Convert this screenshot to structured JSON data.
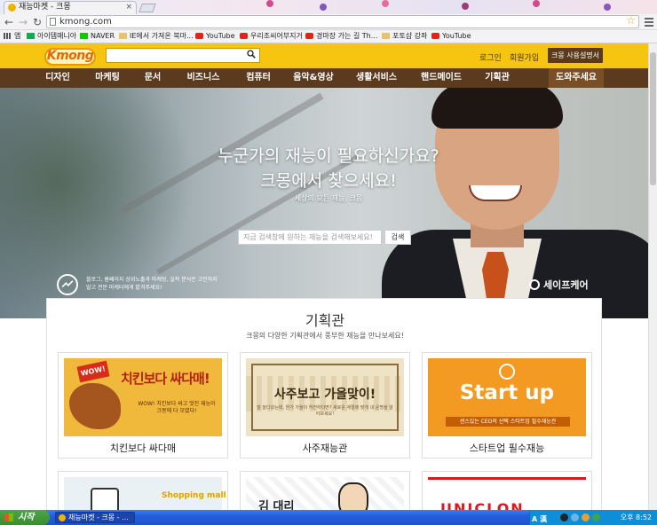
{
  "browser": {
    "tab_title": "재능마켓 - 크몽",
    "url": "kmong.com"
  },
  "bookmarks": [
    {
      "label": "앱",
      "icon": "apps-icon"
    },
    {
      "label": "아이템매니아",
      "icon": "site-icon"
    },
    {
      "label": "NAVER",
      "icon": "naver-icon"
    },
    {
      "label": "IE에서 가져온 북마...",
      "icon": "folder-icon"
    },
    {
      "label": "YouTube",
      "icon": "youtube-icon"
    },
    {
      "label": "우리조씨어부지거",
      "icon": "youtube-icon"
    },
    {
      "label": "경마장 가는 길 Th...",
      "icon": "youtube-icon"
    },
    {
      "label": "포토샵 강좌",
      "icon": "folder-icon"
    },
    {
      "label": "YouTube",
      "icon": "youtube-icon"
    }
  ],
  "header": {
    "logo": "Kmong",
    "search_placeholder": "",
    "login": "로그인",
    "signup": "회원가입",
    "guide_button": "크몽 사용설명서"
  },
  "categories": [
    "디자인",
    "마케팅",
    "문서",
    "비즈니스",
    "컴퓨터",
    "음악&영상",
    "생활서비스",
    "핸드메이드",
    "기획관",
    "도와주세요"
  ],
  "hero": {
    "title_line1": "누군가의 재능이 필요하신가요?",
    "title_line2": "크몽에서 찾으세요!",
    "subtitle": "세상의 모든 재능, 크몽",
    "search_placeholder": "지금 검색창에 원하는 재능을 검색해보세요!",
    "search_button": "검색",
    "promo_text": "블로그, 홈페이지 상위노출과 마케팅, 실적 분석은 고민하지 말고 전문 마케터에게 맡겨주세요!",
    "safe_label": "세이프케어"
  },
  "section": {
    "title": "기획관",
    "subtitle": "크몽의 다양한 기획관에서 풍부한 재능을 만나보세요!",
    "cards": [
      {
        "label": "치킨보다 싸다매",
        "banner_title": "치킨보다 싸다매!",
        "badge": "WOW!",
        "banner_sub": "WOW! 치킨보다 싸고 멋진 재능이 크몽에 다 모였다!"
      },
      {
        "label": "사주재능관",
        "banner_title": "사주보고 가을맞이!",
        "banner_sub": "잘 놀다왔는데, 뭔가 가을이 허전하다면? 새로운 계절에 맞게 내 운명을 알아보세요!"
      },
      {
        "label": "스타트업 필수재능",
        "banner_title": "Start up",
        "banner_sub": "센스있는 CEO의 선택 스타트업 필수재능관"
      }
    ],
    "partial_cards": [
      {
        "text": "Shopping mall"
      },
      {
        "text": "김 대리"
      },
      {
        "text": "UNICLON"
      }
    ]
  },
  "taskbar": {
    "start": "시작",
    "task": "재능마켓 - 크몽 - ...",
    "ime": "A 漢",
    "clock": "오후 8:52"
  },
  "colors": {
    "brand_yellow": "#f6c510",
    "nav_brown": "#5c3a1d",
    "guide_btn": "#5b3a1c"
  }
}
